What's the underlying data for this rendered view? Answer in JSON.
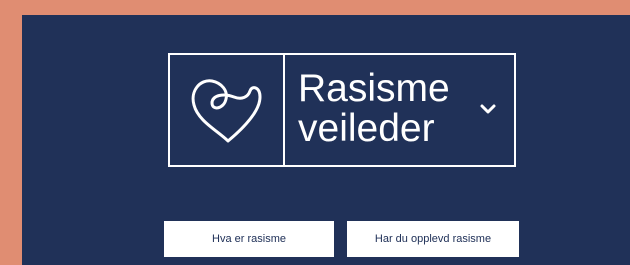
{
  "logo": {
    "line1": "Rasisme",
    "line2": "veileder",
    "icon": "heart-icon",
    "dropdown_icon": "chevron-down-icon"
  },
  "buttons": {
    "what_is_racism": "Hva er rasisme",
    "experienced_racism": "Har du opplevd rasisme"
  },
  "colors": {
    "background": "#e08d72",
    "panel": "#203158",
    "foreground": "#ffffff"
  }
}
